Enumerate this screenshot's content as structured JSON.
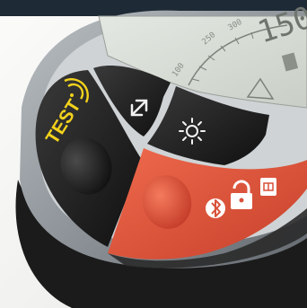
{
  "device": {
    "test_label": "TEST",
    "display_readout": "150",
    "scale_marks": [
      "100",
      "250",
      "300"
    ]
  },
  "buttons": {
    "test": {
      "icon": "test-circle-button",
      "color": "#1c1c1c"
    },
    "range": {
      "icon": "up-down-arrow-icon",
      "color": "#1e1e1e"
    },
    "backlight": {
      "icon": "sun-icon",
      "color": "#1e1e1e"
    },
    "lock": {
      "icon": "lock-icon",
      "color": "#e0533c"
    },
    "bluetooth": {
      "icon": "bluetooth-icon"
    },
    "memory": {
      "icon": "memory-card-icon"
    }
  },
  "colors": {
    "top_bar": "#1e2a36",
    "test_text": "#f2d21c",
    "red_panel": "#e0533c",
    "bezel": "#8d9296",
    "lcd": "#d6dbd3"
  }
}
